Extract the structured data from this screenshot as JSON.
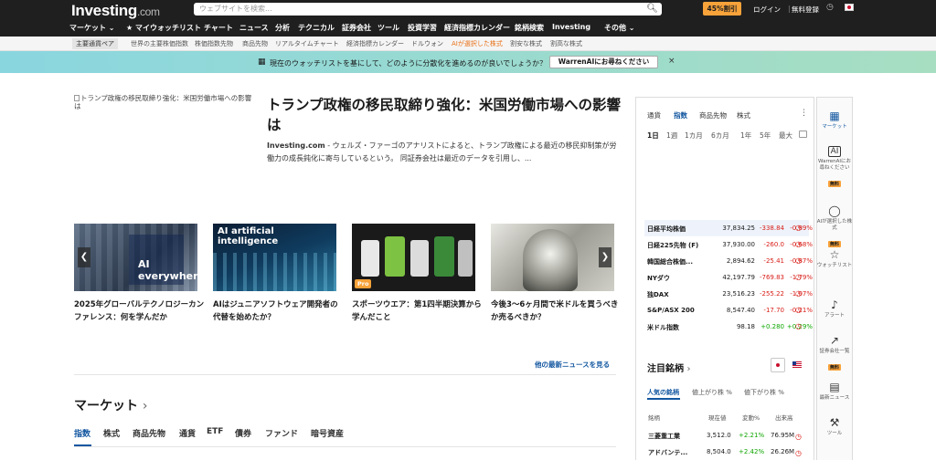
{
  "header": {
    "logo_main": "Investing",
    "logo_suffix": ".com",
    "search_placeholder": "ウェブサイトを検索...",
    "promo_label": "45%割引",
    "login_label": "ログイン",
    "signup_label": "無料登録"
  },
  "nav": {
    "items": [
      "マーケット ⌄",
      "★ マイウォッチリスト",
      "チャート",
      "ニュース",
      "分析",
      "テクニカル",
      "証券会社",
      "ツール",
      "投資学習",
      "経済指標カレンダー",
      "銘柄検索",
      "Investing",
      "その他 ⌄"
    ]
  },
  "subnav": {
    "items": [
      "主要通貨ペア",
      "世界の主要株価指数",
      "株価指数先物",
      "商品先物",
      "リアルタイムチャート",
      "経済指標カレンダー",
      "ドルウォン",
      "AIが選択した株式",
      "割安な株式",
      "割高な株式"
    ]
  },
  "banner": {
    "text": "現在のウォッチリストを基にして、どのように分散化を進めるのが良いでしょうか？",
    "button": "WarrenAIにお尋ねください",
    "close": "×"
  },
  "lead": {
    "image_alt": "トランプ政権の移民取締り強化：米国労働市場への影響は",
    "title": "トランプ政権の移民取締り強化：米国労働市場への影響は",
    "source": "Investing.com",
    "summary": " - ウェルズ・ファーゴのアナリストによると、トランプ政権による最近の移民抑制策が労働力の成長鈍化に寄与しているという。 同証券会社は最近のデータを引用し、..."
  },
  "cards": [
    {
      "title": "2025年グローバルテクノロジーカンファレンス：何を学んだか",
      "image_text": "AI everywhere"
    },
    {
      "title": "AIはジュニアソフトウェア開発者の代替を始めたか？",
      "image_text": "AI artificial intelligence"
    },
    {
      "title": "スポーツウエア：第1四半期決算から学んだこと",
      "badge": "Pro"
    },
    {
      "title": "今後3〜6ヶ月間で米ドルを買うべきか売るべきか？"
    }
  ],
  "more_news": "他の最新ニュースを見る",
  "market": {
    "title": "マーケット",
    "tabs": [
      "指数",
      "株式",
      "商品先物",
      "通貨",
      "ETF",
      "債券",
      "ファンド",
      "暗号資産"
    ]
  },
  "widget": {
    "tabs": [
      "通貨",
      "指数",
      "商品先物",
      "株式"
    ],
    "periods": [
      "1日",
      "1週",
      "1カ月",
      "6カ月",
      "1年",
      "5年",
      "最大"
    ],
    "quotes": [
      {
        "name": "日経平均株価",
        "value": "37,834.25",
        "change": "-338.84",
        "pct": "-0.89%",
        "dir": "neg"
      },
      {
        "name": "日経225先物 (F)",
        "value": "37,930.00",
        "change": "-260.0",
        "pct": "-0.68%",
        "dir": "neg"
      },
      {
        "name": "韓国総合株価...",
        "value": "2,894.62",
        "change": "-25.41",
        "pct": "-0.87%",
        "dir": "neg"
      },
      {
        "name": "NYダウ",
        "value": "42,197.79",
        "change": "-769.83",
        "pct": "-1.79%",
        "dir": "neg"
      },
      {
        "name": "独DAX",
        "value": "23,516.23",
        "change": "-255.22",
        "pct": "-1.07%",
        "dir": "neg"
      },
      {
        "name": "S&P/ASX 200",
        "value": "8,547.40",
        "change": "-17.70",
        "pct": "-0.21%",
        "dir": "neg"
      },
      {
        "name": "米ドル指数",
        "value": "98.18",
        "change": "+0.280",
        "pct": "+0.29%",
        "dir": "pos"
      }
    ],
    "stocks_title": "注目銘柄",
    "stock_tabs": [
      "人気の銘柄",
      "値上がり株 %",
      "値下がり株 %"
    ],
    "stock_headers": [
      "銘柄",
      "現在値",
      "変動%",
      "出来高"
    ],
    "stocks": [
      {
        "name": "三菱重工業",
        "price": "3,512.0",
        "pct": "+2.21%",
        "volume": "76.95M"
      },
      {
        "name": "アドバンテ...",
        "price": "8,504.0",
        "pct": "+2.42%",
        "volume": "26.26M"
      }
    ]
  },
  "sidebar": [
    {
      "label": "マーケット",
      "icon": "bar-chart-icon"
    },
    {
      "label": "WarrenAIにお尋ねください",
      "icon": "ai-icon",
      "badge": "無料"
    },
    {
      "label": "AIが選択した株式",
      "icon": "lightbulb-icon",
      "badge": "無料"
    },
    {
      "label": "ウォッチリスト",
      "icon": "star-icon"
    },
    {
      "label": "アラート",
      "icon": "bell-icon"
    },
    {
      "label": "証券会社一覧",
      "icon": "trend-icon",
      "badge": "無料"
    },
    {
      "label": "最新ニュース",
      "icon": "news-icon"
    },
    {
      "label": "ツール",
      "icon": "wrench-icon"
    }
  ],
  "colors": {
    "accent": "#1256a0",
    "negative": "#d91e18",
    "positive": "#0ea600",
    "promo": "#f8a23a",
    "header": "#1f1f1f"
  }
}
